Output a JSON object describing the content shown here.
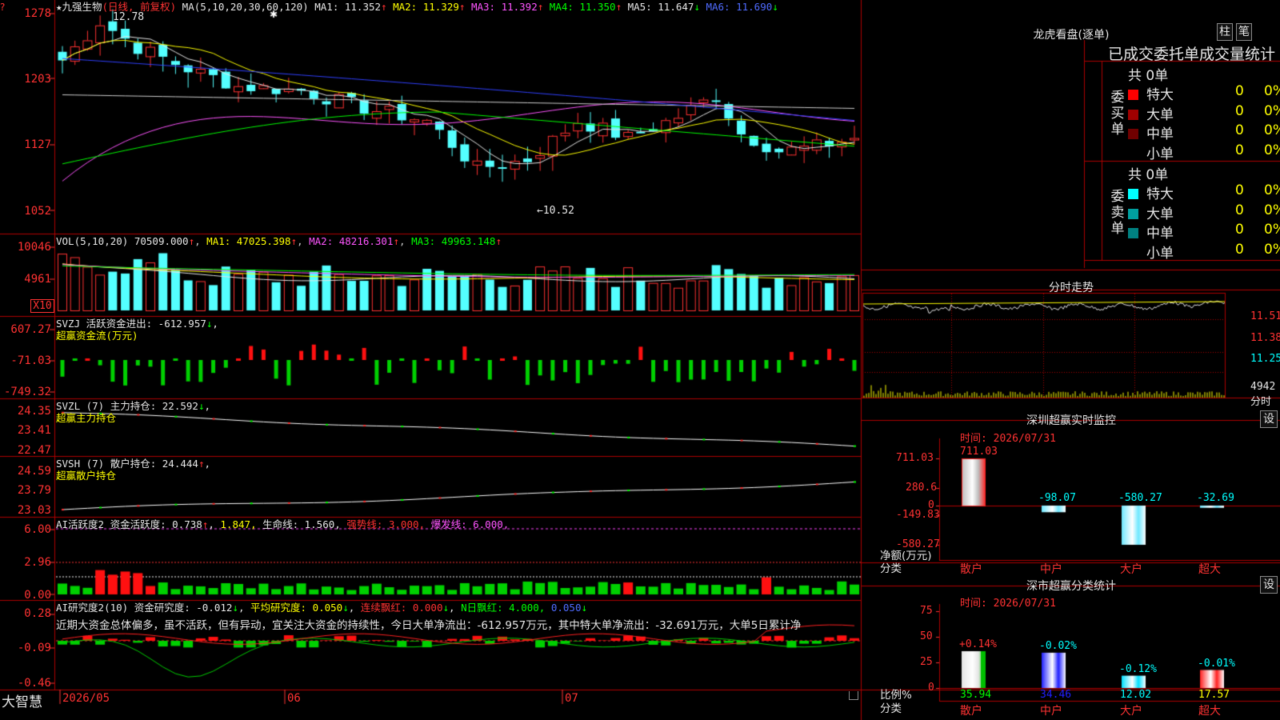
{
  "app": {
    "name": "大智慧"
  },
  "main_chart": {
    "title_star": "★九强生物",
    "period": "(日线, 前复权)",
    "ma_header": "MA(5,10,20,30,60,120)",
    "ma_values": [
      {
        "label": "MA1: 11.352",
        "arrow": "↑",
        "color": "#e6e6e6"
      },
      {
        "label": "MA2: 11.329",
        "arrow": "↑",
        "color": "#ffff00"
      },
      {
        "label": "MA3: 11.392",
        "arrow": "↑",
        "color": "#ff55ff"
      },
      {
        "label": "MA4: 11.350",
        "arrow": "↑",
        "color": "#00ff00"
      },
      {
        "label": "MA5: 11.647",
        "arrow": "↓",
        "color": "#e6e6e6"
      },
      {
        "label": "MA6: 11.690",
        "arrow": "↓",
        "color": "#4f6bff"
      }
    ],
    "y_ticks": [
      "1278",
      "1203",
      "1127",
      "1052"
    ],
    "high_label": "12.78",
    "low_label": "←10.52"
  },
  "vol_panel": {
    "header": "VOL(5,10,20)",
    "value": "70509.000",
    "ma1": "MA1: 47025.398",
    "ma2": "MA2: 48216.301",
    "ma3": "MA3: 49963.148",
    "y_ticks": [
      "10046",
      "4961"
    ],
    "unit": "X10"
  },
  "svzj_panel": {
    "header": "SVZJ  活跃资金进出: -612.957",
    "arrow": "↓",
    "subtitle": "超赢资金流(万元)",
    "y_ticks": [
      "607.27",
      "-71.03",
      "-749.32"
    ]
  },
  "svzl_panel": {
    "header": "SVZL (7) 主力持仓: 22.592",
    "arrow": "↓",
    "subtitle": "超赢主力持仓",
    "y_ticks": [
      "24.35",
      "23.41",
      "22.47"
    ]
  },
  "svsh_panel": {
    "header": "SVSH (7) 散户持仓: 24.444",
    "arrow": "↑",
    "subtitle": "超赢散户持仓",
    "y_ticks": [
      "24.59",
      "23.79",
      "23.03"
    ]
  },
  "ai_active_panel": {
    "header": "AI活跃度2 资金活跃度: 0.738",
    "v2": "1.847,",
    "v3": "生命线: 1.560,",
    "v4": "强势线: 3.000,",
    "v5": "爆发线: 6.000,",
    "y_ticks": [
      "6.00",
      "2.96",
      "0.00"
    ]
  },
  "ai_research_panel": {
    "header": "AI研究度2(10) 资金研究度: -0.012",
    "avg": "平均研究度: 0.050",
    "red": "连续飘红: 0.000",
    "nred": "N日飘红: 4.000,",
    "last": "0.050",
    "note": "近期大资金总体偏多，虽不活跃，但有异动，宜关注大资金的持续性，今日大单净流出：-612.957万元，其中特大单净流出：-32.691万元，大单5日累计净",
    "y_ticks": [
      "0.28",
      "-0.09",
      "-0.46"
    ]
  },
  "x_axis": {
    "labels": [
      "2026/05",
      "06",
      "07"
    ]
  },
  "sidebar": {
    "dragon_title": "龙虎看盘(逐单)",
    "btn_bar": "柱",
    "btn_pen": "笔",
    "stat_header": "已成交委托单成交量统计",
    "buy": {
      "label": "委买单",
      "total": "共 0单",
      "rows": [
        {
          "name": "特大",
          "value": "0",
          "pct": "0%",
          "color": "#ff0000"
        },
        {
          "name": "大单",
          "value": "0",
          "pct": "0%",
          "color": "#a00000"
        },
        {
          "name": "中单",
          "value": "0",
          "pct": "0%",
          "color": "#700000"
        },
        {
          "name": "小单",
          "value": "0",
          "pct": "0%",
          "color": "#000000"
        }
      ]
    },
    "sell": {
      "label": "委卖单",
      "total": "共 0单",
      "rows": [
        {
          "name": "特大",
          "value": "0",
          "pct": "0%",
          "color": "#00ffff"
        },
        {
          "name": "大单",
          "value": "0",
          "pct": "0%",
          "color": "#00a0a0"
        },
        {
          "name": "中单",
          "value": "0",
          "pct": "0%",
          "color": "#008080"
        },
        {
          "name": "小单",
          "value": "0",
          "pct": "0%",
          "color": "#000000"
        }
      ]
    },
    "intraday": {
      "title": "分时走势",
      "ticks": [
        "11.51",
        "11.38",
        "11.25",
        "4942",
        "分时"
      ]
    },
    "sz_monitor": {
      "title": "深圳超赢实时监控",
      "settings": "设",
      "time": "时间: 2026/07/31",
      "y_ticks": [
        "711.03",
        "280.6",
        "0",
        "-149.83",
        "-580.27"
      ],
      "unit1": "净额(万元)",
      "unit2": "分类",
      "bars": [
        {
          "cat": "散户",
          "value": 711.03,
          "label": "711.03"
        },
        {
          "cat": "中户",
          "value": -98.07,
          "label": "-98.07"
        },
        {
          "cat": "大户",
          "value": -580.27,
          "label": "-580.27"
        },
        {
          "cat": "超大",
          "value": -32.69,
          "label": "-32.69"
        }
      ]
    },
    "sz_class": {
      "title": "深市超赢分类统计",
      "settings": "设",
      "time": "时间: 2026/07/31",
      "y_ticks": [
        "75",
        "50",
        "25",
        "0"
      ],
      "unit1": "比例%",
      "unit2": "分类",
      "bars": [
        {
          "cat": "散户",
          "value": 35.94,
          "label": "35.94",
          "chg": "+0.14%",
          "color": "#e6e6e6",
          "accent": "#00c000"
        },
        {
          "cat": "中户",
          "value": 34.46,
          "label": "34.46",
          "chg": "-0.02%",
          "color": "#2020ff",
          "accent": "#ffffff"
        },
        {
          "cat": "大户",
          "value": 12.02,
          "label": "12.02",
          "chg": "-0.12%",
          "color": "#00e0ff",
          "accent": "#ffffff"
        },
        {
          "cat": "超大",
          "value": 17.57,
          "label": "17.57",
          "chg": "-0.01%",
          "color": "#ff2020",
          "accent": "#ffffff"
        }
      ]
    }
  }
}
